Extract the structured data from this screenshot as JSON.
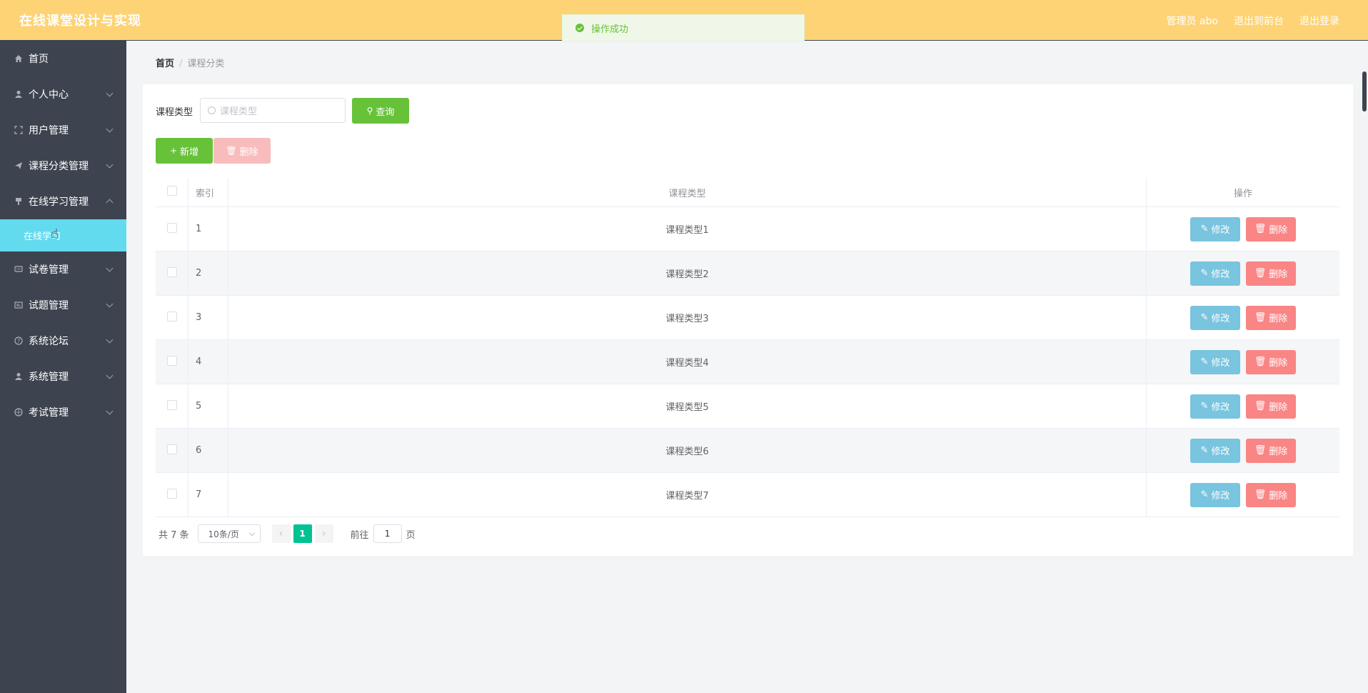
{
  "header": {
    "title": "在线课堂设计与实现",
    "links": [
      "管理员 abo",
      "退出到前台",
      "退出登录"
    ]
  },
  "toast": {
    "message": "操作成功"
  },
  "sidebar": {
    "items": [
      {
        "label": "首页",
        "icon": "home-icon"
      },
      {
        "label": "个人中心",
        "icon": "user-icon"
      },
      {
        "label": "用户管理",
        "icon": "fullscreen-icon"
      },
      {
        "label": "课程分类管理",
        "icon": "send-icon"
      },
      {
        "label": "在线学习管理",
        "icon": "brush-icon"
      },
      {
        "label": "试卷管理",
        "icon": "message-icon"
      },
      {
        "label": "试题管理",
        "icon": "tickets-icon"
      },
      {
        "label": "系统论坛",
        "icon": "help-icon"
      },
      {
        "label": "系统管理",
        "icon": "user-icon"
      },
      {
        "label": "考试管理",
        "icon": "basketball-icon"
      }
    ],
    "sub_item": "在线学习"
  },
  "breadcrumb": {
    "home": "首页",
    "separator": "/",
    "current": "课程分类"
  },
  "filter": {
    "label": "课程类型",
    "placeholder": "课程类型",
    "query_label": "查询"
  },
  "actions": {
    "add_label": "新增",
    "delete_label": "删除"
  },
  "table": {
    "headers": {
      "index": "索引",
      "name": "课程类型",
      "op": "操作"
    },
    "edit_label": "修改",
    "delete_label": "删除",
    "rows": [
      {
        "index": "1",
        "name": "课程类型1"
      },
      {
        "index": "2",
        "name": "课程类型2"
      },
      {
        "index": "3",
        "name": "课程类型3"
      },
      {
        "index": "4",
        "name": "课程类型4"
      },
      {
        "index": "5",
        "name": "课程类型5"
      },
      {
        "index": "6",
        "name": "课程类型6"
      },
      {
        "index": "7",
        "name": "课程类型7"
      }
    ]
  },
  "pagination": {
    "total": "共 7 条",
    "page_size": "10条/页",
    "current": "1",
    "goto_prefix": "前往",
    "goto_value": "1",
    "goto_suffix": "页"
  },
  "colors": {
    "header": "#fdd375",
    "sidebar": "#3d4450",
    "active": "#62dbef",
    "success": "#67c23a",
    "danger": "#f98585",
    "info": "#79c4de",
    "pager": "#00c292"
  }
}
